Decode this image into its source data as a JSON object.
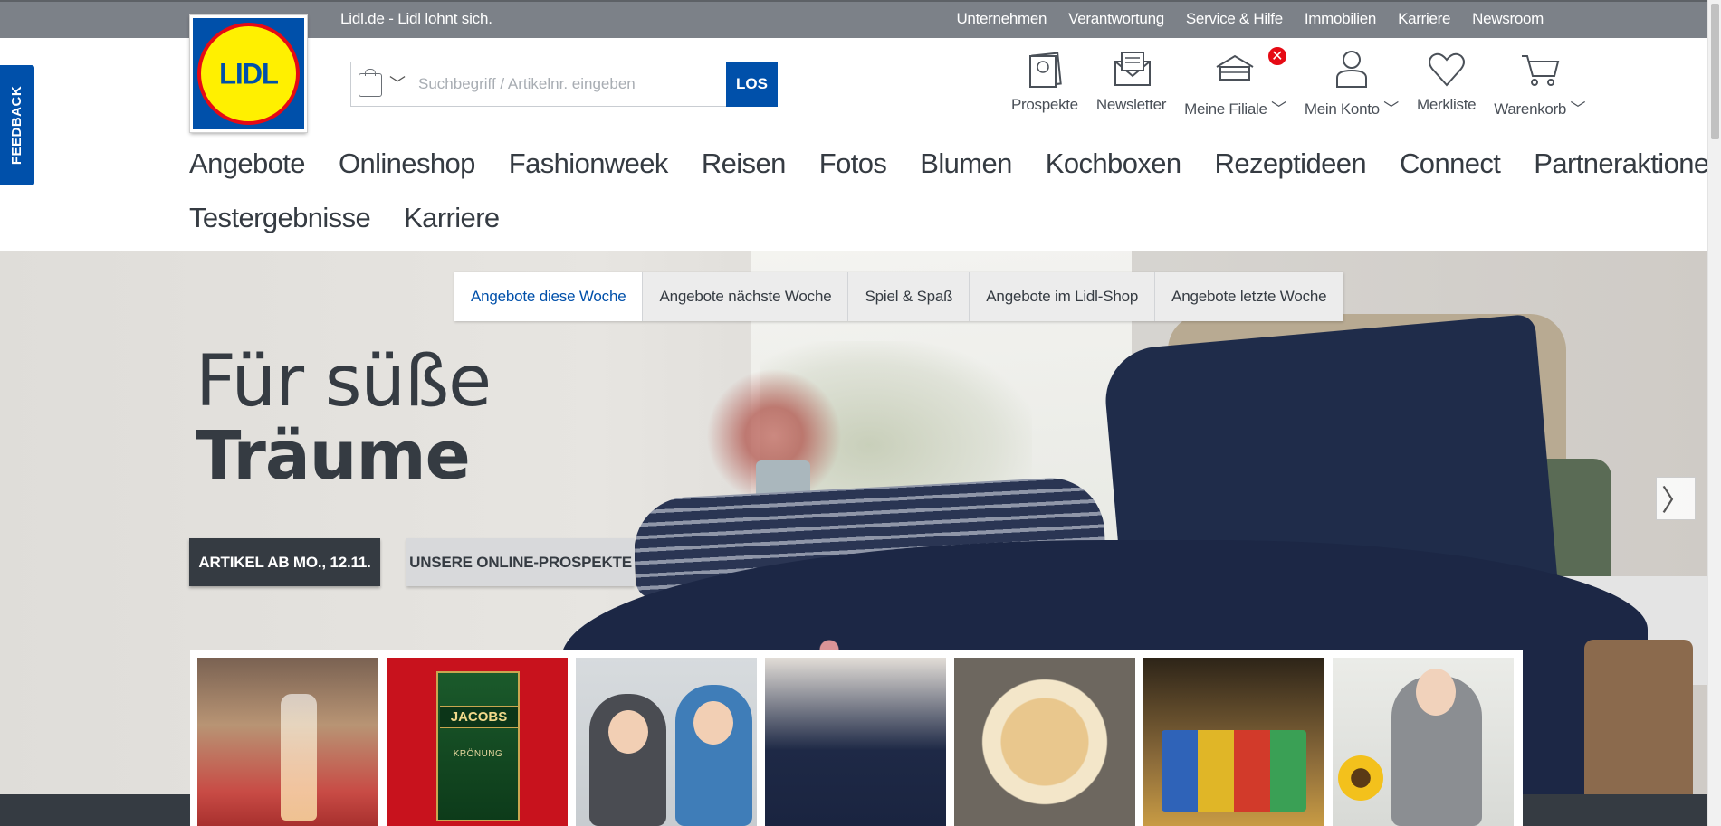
{
  "topbar": {
    "tagline": "Lidl.de - Lidl lohnt sich.",
    "links": [
      "Unternehmen",
      "Verantwortung",
      "Service & Hilfe",
      "Immobilien",
      "Karriere",
      "Newsroom"
    ]
  },
  "logo": {
    "text": "LIDL"
  },
  "feedback": {
    "label": "FEEDBACK"
  },
  "search": {
    "placeholder": "Suchbegriff / Artikelnr. eingeben",
    "button": "LOS"
  },
  "actions": {
    "prospekte": "Prospekte",
    "newsletter": "Newsletter",
    "filiale": "Meine Filiale",
    "konto": "Mein Konto",
    "merkliste": "Merkliste",
    "warenkorb": "Warenkorb",
    "filiale_badge": "✕"
  },
  "mainnav": [
    "Angebote",
    "Onlineshop",
    "Fashionweek",
    "Reisen",
    "Fotos",
    "Blumen",
    "Kochboxen",
    "Rezeptideen",
    "Connect",
    "Partneraktionen"
  ],
  "subnav": [
    "Testergebnisse",
    "Karriere"
  ],
  "hero": {
    "tabs": [
      "Angebote diese Woche",
      "Angebote nächste Woche",
      "Spiel & Spaß",
      "Angebote im Lidl-Shop",
      "Angebote letzte Woche"
    ],
    "active_tab": 0,
    "headline_line1": "Für süße",
    "headline_line2": "Träume",
    "cta_primary": "ARTIKEL AB MO., 12.11.",
    "cta_secondary": "UNSERE ONLINE-PROSPEKTE",
    "next_arrow": "〉"
  },
  "thumbs": {
    "jacobs_brand": "JACOBS",
    "jacobs_sub": "KRÖNUNG"
  },
  "colors": {
    "brand_blue": "#0050aa",
    "brand_yellow": "#fff000",
    "brand_red": "#e60a14",
    "topbar_gray": "#7c8188",
    "text_dark": "#353b42"
  }
}
